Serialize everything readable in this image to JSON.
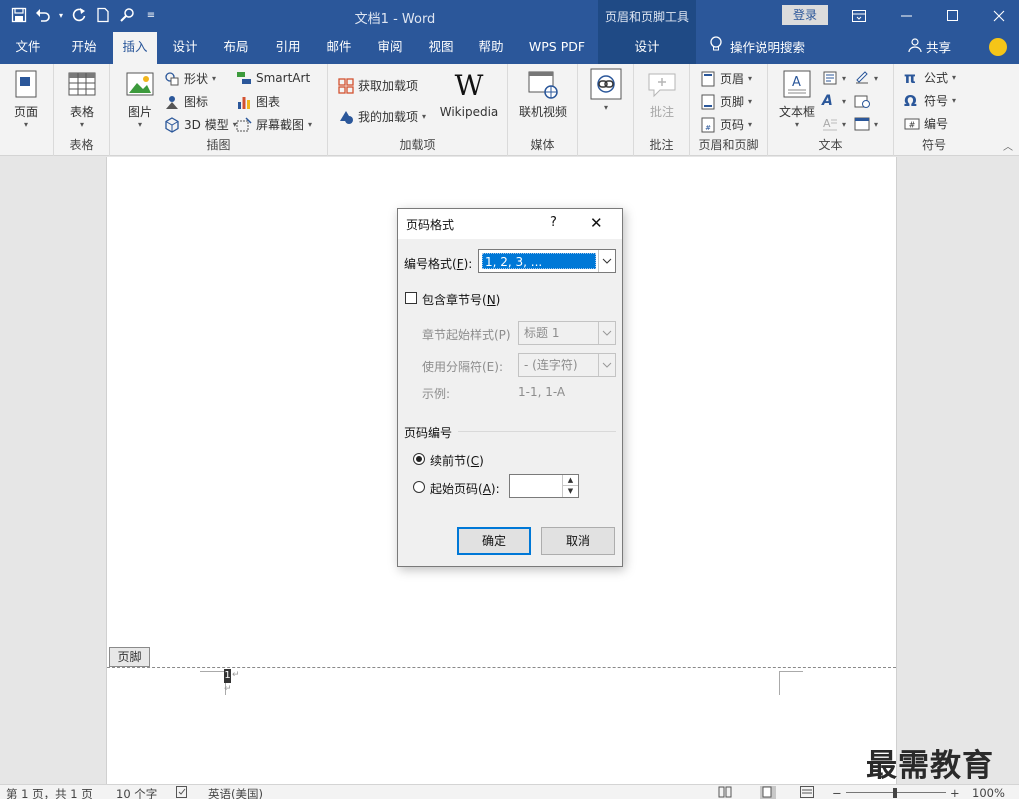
{
  "titlebar": {
    "doc_title": "文档1  -  Word",
    "context_title": "页眉和页脚工具",
    "login": "登录",
    "qat": [
      "save-icon",
      "undo-icon",
      "redo-icon",
      "new-doc-icon",
      "touch-mode-icon",
      "customize-qat-icon"
    ]
  },
  "tabs": [
    {
      "label": "文件"
    },
    {
      "label": "开始"
    },
    {
      "label": "插入"
    },
    {
      "label": "设计"
    },
    {
      "label": "布局"
    },
    {
      "label": "引用"
    },
    {
      "label": "邮件"
    },
    {
      "label": "审阅"
    },
    {
      "label": "视图"
    },
    {
      "label": "帮助"
    },
    {
      "label": "WPS PDF"
    },
    {
      "label": "设计"
    }
  ],
  "tellme": "操作说明搜索",
  "share": "共享",
  "ribbon": {
    "pages": {
      "btn": "页面",
      "group": ""
    },
    "tables": {
      "btn": "表格",
      "group": "表格"
    },
    "illustrations": {
      "picture": "图片",
      "shapes": "形状",
      "icons": "图标",
      "model3d": "3D 模型",
      "smartart": "SmartArt",
      "chart": "图表",
      "screenshot": "屏幕截图",
      "group": "插图"
    },
    "addins": {
      "get": "获取加载项",
      "mine": "我的加载项",
      "wikipedia": "Wikipedia",
      "group": "加载项"
    },
    "media": {
      "video": "联机视频",
      "group": "媒体"
    },
    "links": {
      "link": "链接",
      "group": ""
    },
    "comments": {
      "comment": "批注",
      "group": "批注"
    },
    "headerfooter": {
      "header": "页眉",
      "footer": "页脚",
      "pagenum": "页码",
      "group": "页眉和页脚"
    },
    "text": {
      "textbox": "文本框",
      "group": "文本"
    },
    "symbols": {
      "equation": "公式",
      "symbol": "符号",
      "number": "编号",
      "group": "符号"
    }
  },
  "document": {
    "footer_tag": "页脚",
    "page_number": "1"
  },
  "dialog": {
    "title": "页码格式",
    "help": "?",
    "close": "✕",
    "format_label": "编号格式(",
    "format_key": "F",
    "format_value": "1, 2, 3, ...",
    "include_chapter": "包含章节号(",
    "include_chapter_key": "N",
    "chapter_style_label": "章节起始样式(P)",
    "chapter_style_value": "标题 1",
    "separator_label": "使用分隔符(E):",
    "separator_value": "-   (连字符)",
    "example_label": "示例:",
    "example_value": "1-1, 1-A",
    "numbering_section": "页码编号",
    "continue_label": "续前节(",
    "continue_key": "C",
    "start_at_label": "起始页码(",
    "start_at_key": "A",
    "start_at_value": "",
    "ok": "确定",
    "cancel": "取消"
  },
  "statusbar": {
    "page": "第 1 页，共 1 页",
    "words": "10 个字",
    "language": "英语(美国)",
    "zoom": "100%"
  },
  "watermark": "最需教育",
  "colors": {
    "brand": "#2b579a",
    "context": "#1f4a85",
    "selection": "#0078d7"
  }
}
